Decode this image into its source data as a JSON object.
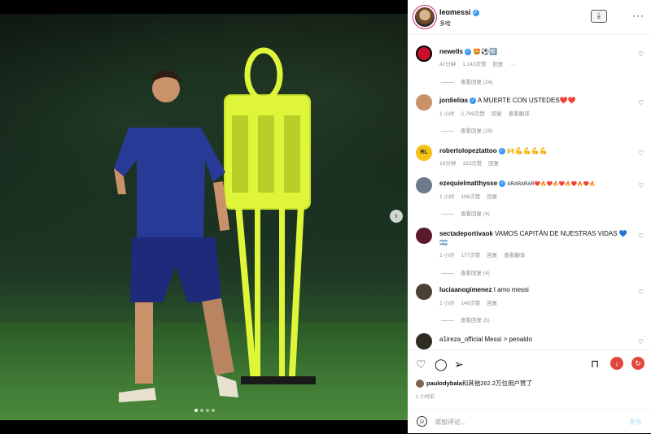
{
  "post_image": {
    "alt": "",
    "dot_count": 4,
    "active_dot": 0
  },
  "header": {
    "username": "leomessi",
    "location": "多哈",
    "verified": true
  },
  "comments": [
    {
      "username": "newells",
      "verified": true,
      "text": "🤩⚽🔟",
      "time": "41分钟",
      "likes": "1,143次赞",
      "reply": "回复",
      "more": "···",
      "view_replies": "查看回复 (24)"
    },
    {
      "username": "jordielias",
      "verified": true,
      "text": "A MUERTE CON USTEDES❤️❤️",
      "time": "1 小时",
      "likes": "2,769次赞",
      "reply": "回复",
      "translate": "查看翻译",
      "view_replies": "查看回复 (29)"
    },
    {
      "username": "robertolopeztattoo",
      "verified": true,
      "text": "🙌💪💪💪💪",
      "time": "16分钟",
      "likes": "153次赞",
      "reply": "回复"
    },
    {
      "username": "ezequielmatthysse",
      "verified": true,
      "text": "ARARARAR❤️🔥❤️🔥❤️🔥❤️🔥❤️🔥",
      "time": "1 小时",
      "likes": "196次赞",
      "reply": "回复",
      "view_replies": "查看回复 (4)"
    },
    {
      "username": "sectadeportivaok",
      "verified": false,
      "text": "VAMOS CAPITÁN DE NUESTRAS VIDAS 💙 🇦🇷",
      "time": "1 小时",
      "likes": "177次赞",
      "reply": "回复",
      "translate": "查看翻译",
      "view_replies": "查看回复 (4)"
    },
    {
      "username": "luciaanogimenez",
      "verified": false,
      "text": "I amo messi",
      "time": "1 小时",
      "likes": "149次赞",
      "reply": "回复",
      "view_replies": "查看回复 (5)"
    },
    {
      "username": "a1ireza_official",
      "verified": false,
      "text": "Messi > penaldo"
    }
  ],
  "actions": {
    "like_icon": "heart-icon",
    "comment_icon": "comment-icon",
    "share_icon": "send-icon",
    "save_icon": "bookmark-icon"
  },
  "likes_line": {
    "user": "paulodybala",
    "rest": "和其他262.2万位用户赞了"
  },
  "post_time": "1 小时前",
  "comment_box": {
    "placeholder": "添加评论...",
    "post_label": "发布"
  },
  "colors": {
    "accent_blue": "#3897f0",
    "post_disabled": "#b2dffc",
    "red_badge": "#e0483c"
  }
}
